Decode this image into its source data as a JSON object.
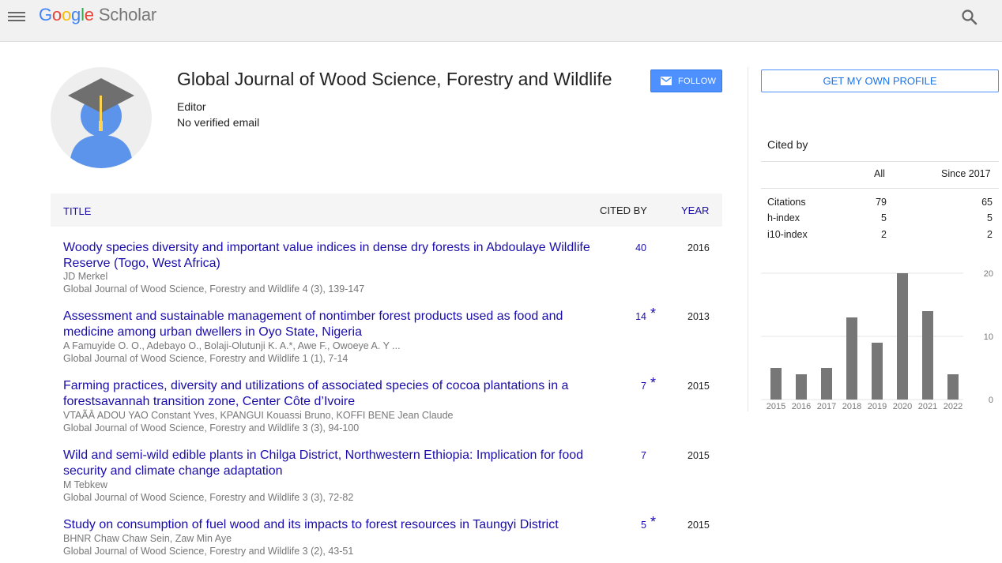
{
  "header": {
    "logo": {
      "letters": [
        "G",
        "o",
        "o",
        "g",
        "l",
        "e"
      ],
      "product": "Scholar"
    },
    "menu_icon": "hamburger-menu-icon",
    "search_icon": "search-icon"
  },
  "profile": {
    "name": "Global Journal of Wood Science, Forestry and Wildlife",
    "affiliation": "Editor",
    "email": "No verified email",
    "follow_label": "FOLLOW",
    "follow_icon": "envelope-icon",
    "avatar_icon": "graduate-cap-avatar-icon"
  },
  "table": {
    "headers": {
      "title": "TITLE",
      "cited_by": "CITED BY",
      "year": "YEAR"
    },
    "rows": [
      {
        "title": "Woody species diversity and important value indices in dense dry forests in Abdoulaye Wildlife Reserve (Togo, West Africa)",
        "authors": "JD Merkel",
        "journal": "Global Journal of Wood Science, Forestry and Wildlife 4 (3), 139-147",
        "cited": "40",
        "star": "",
        "year": "2016"
      },
      {
        "title": "Assessment and sustainable management of nontimber forest products used as food and medicine among urban dwellers in Oyo State, Nigeria",
        "authors": "A Famuyide O. O., Adebayo O., Bolaji-Olutunji K. A.*, Awe F., Owoeye A. Y ...",
        "journal": "Global Journal of Wood Science, Forestry and Wildlife 1 (1), 7-14",
        "cited": "14",
        "star": "*",
        "year": "2013"
      },
      {
        "title": "Farming practices, diversity and utilizations of associated species of cocoa plantations in a forestsavannah transition zone, Center Côte d’Ivoire",
        "authors": "VTAÃÂ ADOU YAO Constant Yves, KPANGUI Kouassi Bruno, KOFFI BENE Jean Claude",
        "journal": "Global Journal of Wood Science, Forestry and Wildlife 3 (3), 94-100",
        "cited": "7",
        "star": "*",
        "year": "2015"
      },
      {
        "title": "Wild and semi-wild edible plants in Chilga District, Northwestern Ethiopia: Implication for food security and climate change adaptation",
        "authors": "M Tebkew",
        "journal": "Global Journal of Wood Science, Forestry and Wildlife 3 (3), 72-82",
        "cited": "7",
        "star": "",
        "year": "2015"
      },
      {
        "title": "Study on consumption of fuel wood and its impacts to forest resources in Taungyi District",
        "authors": "BHNR Chaw Chaw Sein, Zaw Min Aye",
        "journal": "Global Journal of Wood Science, Forestry and Wildlife 3 (2), 43-51",
        "cited": "5",
        "star": "*",
        "year": "2015"
      }
    ]
  },
  "sidebar": {
    "get_profile_label": "GET MY OWN PROFILE",
    "cited_by_title": "Cited by",
    "stats": {
      "col_all": "All",
      "col_since": "Since 2017",
      "rows": [
        {
          "label": "Citations",
          "all": "79",
          "since": "65"
        },
        {
          "label": "h-index",
          "all": "5",
          "since": "5"
        },
        {
          "label": "i10-index",
          "all": "2",
          "since": "2"
        }
      ]
    }
  },
  "chart_data": {
    "type": "bar",
    "categories": [
      "2015",
      "2016",
      "2017",
      "2018",
      "2019",
      "2020",
      "2021",
      "2022"
    ],
    "values": [
      5,
      4,
      5,
      13,
      9,
      20,
      14,
      4
    ],
    "ylim": [
      0,
      20
    ],
    "yticks": [
      "0",
      "10",
      "20"
    ],
    "bar_color": "#777777",
    "grid": true
  }
}
